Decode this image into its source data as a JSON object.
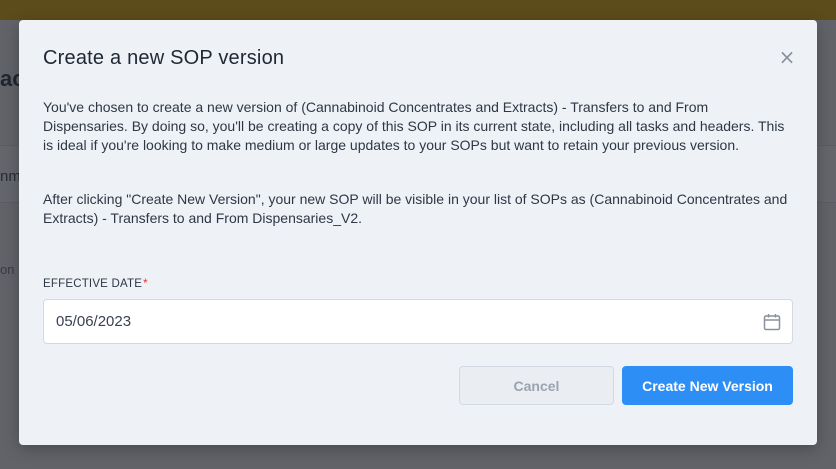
{
  "modal": {
    "title": "Create a new SOP version",
    "close_label": "×",
    "paragraph1": "You've chosen to create a new version of (Cannabinoid Concentrates and Extracts) - Transfers to and From Dispensaries. By doing so, you'll be creating a copy of this SOP in its current state, including all tasks and headers. This is ideal if you're looking to make medium or large updates to your SOPs but want to retain your previous version.",
    "paragraph2": "After clicking \"Create New Version\", your new SOP will be visible in your list of SOPs as (Cannabinoid Concentrates and Extracts) - Transfers to and From Dispensaries_V2.",
    "effective_date_label": "EFFECTIVE DATE",
    "required_marker": "*",
    "effective_date_value": "05/06/2023",
    "cancel_label": "Cancel",
    "create_label": "Create New Version"
  },
  "background": {
    "title_fragment": "act",
    "row_fragment": "nm",
    "small_fragment": "on"
  },
  "colors": {
    "accent": "#2d8ef5",
    "required": "#e0342f",
    "top_bar": "#e0a800"
  },
  "icons": {
    "close": "close-icon",
    "calendar": "calendar-icon"
  }
}
